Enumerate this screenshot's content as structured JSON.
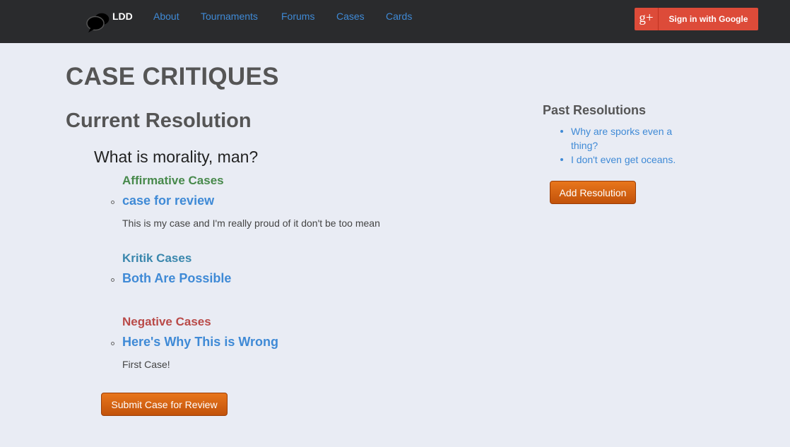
{
  "nav": {
    "brand": "LDD",
    "links": [
      "About",
      "Tournaments",
      "Forums",
      "Cases",
      "Cards"
    ],
    "google_icon": "g+",
    "google_button": "Sign in with Google"
  },
  "main": {
    "title": "CASE CRITIQUES",
    "section": "Current Resolution",
    "resolution": "What is morality, man?",
    "categories": {
      "affirmative": {
        "label": "Affirmative Cases",
        "case": {
          "title": "case for review",
          "description": "This is my case and I'm really proud of it don't be too mean"
        }
      },
      "kritik": {
        "label": "Kritik Cases",
        "case": {
          "title": "Both Are Possible"
        }
      },
      "negative": {
        "label": "Negative Cases",
        "case": {
          "title": "Here's Why This is Wrong",
          "description": "First Case!"
        }
      }
    },
    "submit_button": "Submit Case for Review"
  },
  "sidebar": {
    "title": "Past Resolutions",
    "items": [
      "Why are sporks even a thing?",
      "I don't even get oceans."
    ],
    "add_button": "Add Resolution"
  },
  "colors": {
    "navbar": "#2a2b2d",
    "link": "#3f8ad6",
    "affirmative": "#47894b",
    "kritik": "#3a87ad",
    "negative": "#b94a48",
    "button": "#d9620f",
    "google": "#dd4b39"
  }
}
